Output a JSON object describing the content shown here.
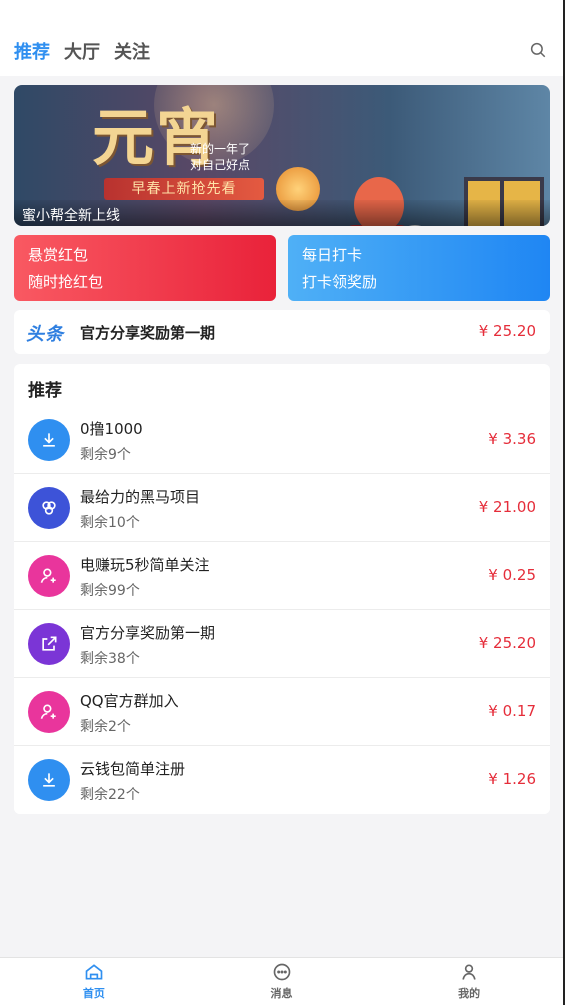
{
  "header": {
    "tabs": [
      {
        "label": "推荐",
        "active": true
      },
      {
        "label": "大厅",
        "active": false
      },
      {
        "label": "关注",
        "active": false
      }
    ],
    "search_icon": "search-icon"
  },
  "banner": {
    "title": "元宵",
    "subtitle_line1": "新的一年了",
    "subtitle_line2": "对自己好点",
    "button_text": "早春上新抢先看",
    "caption": "蜜小帮全新上线"
  },
  "promos": [
    {
      "line1": "悬赏红包",
      "line2": "随时抢红包",
      "color": "#ef3346"
    },
    {
      "line1": "每日打卡",
      "line2": "打卡领奖励",
      "color": "#2b8ff4"
    }
  ],
  "notice": {
    "logo_text": "头条",
    "title": "官方分享奖励第一期",
    "price": "¥ 25.20"
  },
  "recommend": {
    "section_title": "推荐",
    "items": [
      {
        "title": "0撸1000",
        "remaining": "剩余9个",
        "price": "¥ 3.36",
        "icon": "download-icon",
        "icon_color": "#2f8ff0"
      },
      {
        "title": "最给力的黑马项目",
        "remaining": "剩余10个",
        "price": "¥ 21.00",
        "icon": "circles-icon",
        "icon_color": "#3d53d8"
      },
      {
        "title": "电赚玩5秒简单关注",
        "remaining": "剩余99个",
        "price": "¥ 0.25",
        "icon": "user-add-icon",
        "icon_color": "#e9359c"
      },
      {
        "title": "官方分享奖励第一期",
        "remaining": "剩余38个",
        "price": "¥ 25.20",
        "icon": "share-icon",
        "icon_color": "#7b35d6"
      },
      {
        "title": "QQ官方群加入",
        "remaining": "剩余2个",
        "price": "¥ 0.17",
        "icon": "user-add-icon",
        "icon_color": "#e9359c"
      },
      {
        "title": "云钱包简单注册",
        "remaining": "剩余22个",
        "price": "¥ 1.26",
        "icon": "download-icon",
        "icon_color": "#2f8ff0"
      }
    ]
  },
  "bottom_nav": [
    {
      "label": "首页",
      "icon": "home-icon",
      "active": true
    },
    {
      "label": "消息",
      "icon": "message-icon",
      "active": false
    },
    {
      "label": "我的",
      "icon": "user-icon",
      "active": false
    }
  ]
}
